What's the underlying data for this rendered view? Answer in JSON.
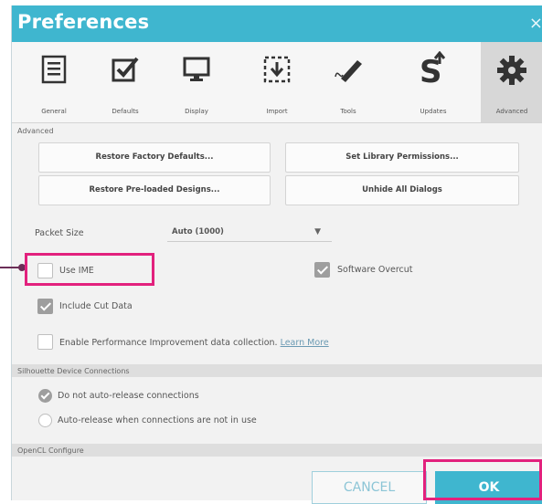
{
  "window": {
    "title": "Preferences",
    "close_glyph": "×"
  },
  "toolbar": {
    "items": [
      {
        "label": "General",
        "icon": "list-icon"
      },
      {
        "label": "Defaults",
        "icon": "checkbox-icon"
      },
      {
        "label": "Display",
        "icon": "monitor-icon"
      },
      {
        "label": "Import",
        "icon": "import-icon"
      },
      {
        "label": "Tools",
        "icon": "pen-icon"
      },
      {
        "label": "Updates",
        "icon": "updates-icon"
      },
      {
        "label": "Advanced",
        "icon": "gear-icon"
      }
    ]
  },
  "advanced": {
    "section_label": "Advanced",
    "buttons": {
      "restore_factory": "Restore Factory Defaults...",
      "set_library": "Set Library Permissions...",
      "restore_preloaded": "Restore Pre-loaded Designs...",
      "unhide_dialogs": "Unhide All Dialogs"
    },
    "packet_size_label": "Packet Size",
    "packet_size_value": "Auto (1000)",
    "use_ime_label": "Use IME",
    "software_overcut_label": "Software Overcut",
    "include_cut_data_label": "Include Cut Data",
    "enable_perf_label": "Enable Performance Improvement data collection.",
    "learn_more": "Learn More"
  },
  "connections": {
    "section_label": "Silhouette Device Connections",
    "option1": "Do not auto-release connections",
    "option2": "Auto-release when connections are not in use"
  },
  "opencl": {
    "section_label": "OpenCL Configure"
  },
  "footer": {
    "cancel": "CANCEL",
    "ok": "OK"
  },
  "colors": {
    "title_bar": "#3fb6cf",
    "highlight": "#e2217d",
    "ok_button": "#3fb6cf"
  }
}
